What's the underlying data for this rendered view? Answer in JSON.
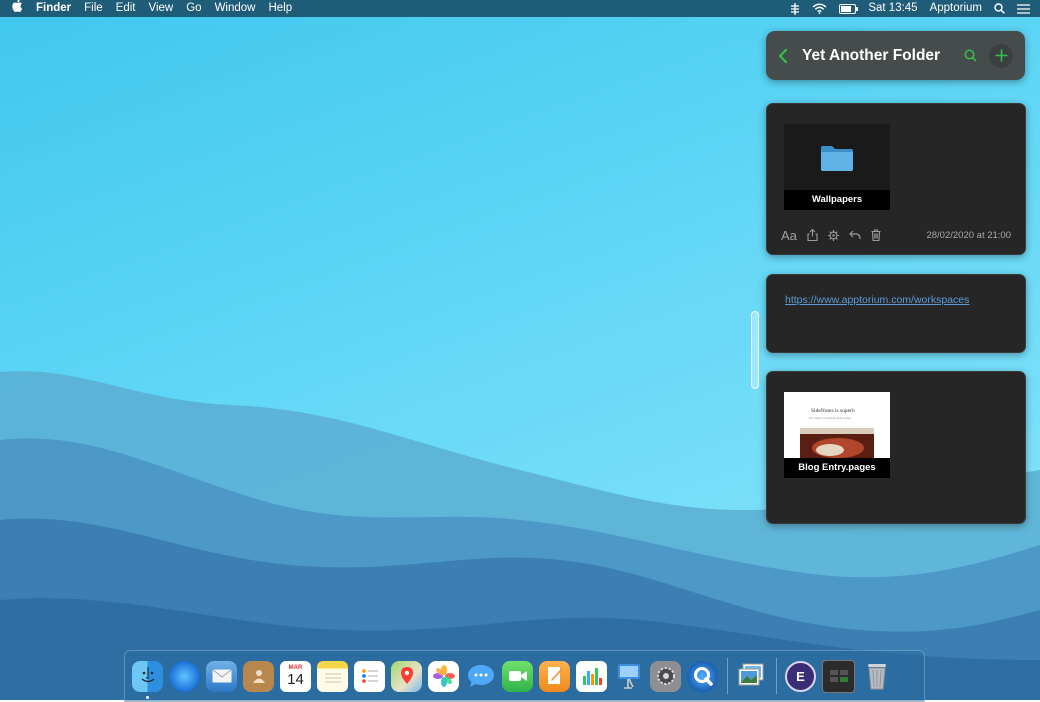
{
  "menubar": {
    "apple_icon": "apple-logo",
    "app_name": "Finder",
    "items": [
      "File",
      "Edit",
      "View",
      "Go",
      "Window",
      "Help"
    ],
    "clock": "Sat 13:45",
    "user": "Apptorium"
  },
  "panel": {
    "title": "Yet Another Folder",
    "note1": {
      "attachment_label": "Wallpapers",
      "font_button_label": "Aa",
      "date": "28/02/2020 at 21:00"
    },
    "note2": {
      "link": "https://www.apptorium.com/workspaces"
    },
    "note3": {
      "attachment_label": "Blog Entry.pages",
      "preview_heading": "SideNotes is superb",
      "preview_subtitle": "let's hear you about side notes"
    }
  },
  "dock": {
    "apps": [
      "Finder",
      "Safari",
      "Mail",
      "Contacts",
      "Calendar",
      "Notes",
      "Reminders",
      "Maps",
      "Photos",
      "Messages",
      "FaceTime",
      "Pages",
      "Numbers",
      "Keynote",
      "System Preferences",
      "QuickTime Player",
      "Preview",
      "Workspaces",
      "Terminal",
      "Trash"
    ],
    "calendar_month": "MAR",
    "calendar_day": "14",
    "workspaces_letter": "E"
  },
  "colors": {
    "accent_green": "#35c24a",
    "menubar_bg": "#1f5c78",
    "card_bg": "#262626",
    "link": "#5b9bd8"
  }
}
